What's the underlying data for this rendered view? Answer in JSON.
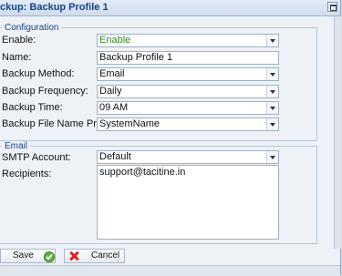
{
  "window": {
    "title": "ckup: Backup Profile 1"
  },
  "configuration": {
    "legend": "Configuration",
    "enable": {
      "label": "Enable:",
      "value": "Enable"
    },
    "name": {
      "label": "Name:",
      "value": "Backup Profile 1"
    },
    "method": {
      "label": "Backup Method:",
      "value": "Email"
    },
    "frequency": {
      "label": "Backup Frequency:",
      "value": "Daily"
    },
    "time": {
      "label": "Backup Time:",
      "value": "09 AM"
    },
    "prefix": {
      "label": "Backup File Name Prefix:",
      "value": "SystemName"
    }
  },
  "email": {
    "legend": "Email",
    "smtp": {
      "label": "SMTP Account:",
      "value": "Default"
    },
    "recipients": {
      "label": "Recipients:",
      "value": "support@tacitine.in"
    }
  },
  "footer": {
    "save_label": "Save",
    "cancel_label": "Cancel"
  },
  "colors": {
    "title": "#15428b",
    "enable_value": "#2e8b22",
    "cancel_icon": "#dd2222",
    "save_icon": "#5fb042"
  }
}
